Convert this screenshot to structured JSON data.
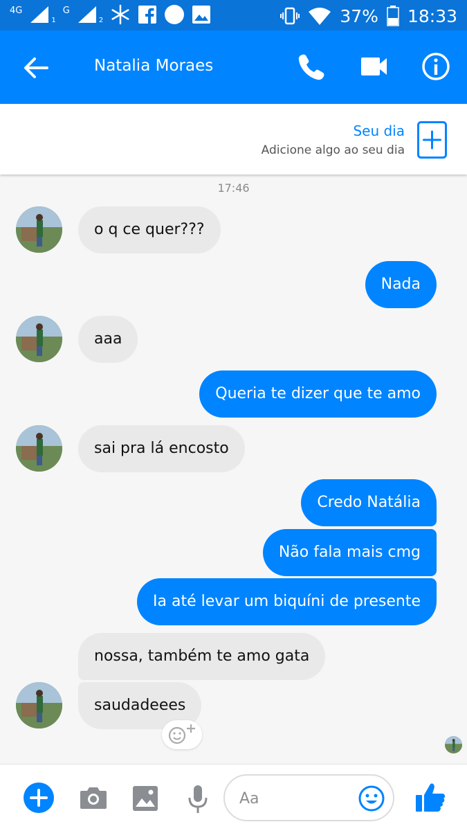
{
  "status_bar": {
    "network_1": "4G",
    "sim_1": "1",
    "network_2": "G",
    "sim_2": "2",
    "battery": "37%",
    "time": "18:33",
    "icons": [
      "signal-icon",
      "snowflake-icon",
      "facebook-icon",
      "circle-icon",
      "image-notification-icon",
      "vibrate-icon",
      "wifi-icon",
      "battery-icon"
    ]
  },
  "header": {
    "contact_name": "Natalia Moraes",
    "icons": [
      "back-arrow-icon",
      "phone-icon",
      "video-camera-icon",
      "info-icon"
    ]
  },
  "story": {
    "title": "Seu dia",
    "subtitle": "Adicione algo ao seu dia"
  },
  "chat": {
    "timestamp": "17:46",
    "messages": [
      {
        "from": "them",
        "text": "o q ce quer???"
      },
      {
        "from": "me",
        "text": "Nada"
      },
      {
        "from": "them",
        "text": "aaa"
      },
      {
        "from": "me",
        "text": "Queria te dizer que te amo"
      },
      {
        "from": "them",
        "text": "sai pra lá encosto"
      },
      {
        "from": "me",
        "text": "Credo Natália"
      },
      {
        "from": "me",
        "text": "Não fala mais cmg"
      },
      {
        "from": "me",
        "text": "Ia até levar um biquíni de presente"
      },
      {
        "from": "them",
        "text": "nossa, também te amo gata"
      },
      {
        "from": "them",
        "text": "saudadeees"
      }
    ]
  },
  "composer": {
    "placeholder": "Aa",
    "icons": [
      "plus-icon",
      "camera-icon",
      "gallery-icon",
      "microphone-icon",
      "emoji-icon",
      "thumbs-up-icon"
    ]
  },
  "colors": {
    "brand": "#0084ff",
    "status_bar": "#0a74d9",
    "incoming_bubble": "#e9e9ea",
    "outgoing_bubble": "#0084ff"
  }
}
